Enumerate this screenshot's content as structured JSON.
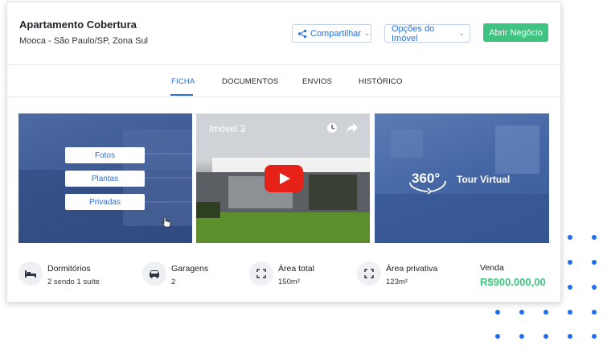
{
  "header": {
    "title": "Apartamento Cobertura",
    "address": "Mooca - São Paulo/SP, Zona Sul",
    "share_label": "Compartilhar",
    "options_label": "Opções do Imóvel",
    "open_deal_label": "Abrir Negócio"
  },
  "tabs": [
    {
      "label": "FICHA",
      "active": true
    },
    {
      "label": "DOCUMENTOS",
      "active": false
    },
    {
      "label": "ENVIOS",
      "active": false
    },
    {
      "label": "HISTÓRICO",
      "active": false
    }
  ],
  "media": {
    "photo_buttons": [
      "Fotos",
      "Plantas",
      "Privadas"
    ],
    "video_title": "Imóvel 3",
    "tour_number": "360°",
    "tour_label": "Tour Virtual"
  },
  "stats": [
    {
      "icon": "bed-icon",
      "label": "Dormitórios",
      "value": "2 sendo 1 suíte"
    },
    {
      "icon": "car-icon",
      "label": "Garagens",
      "value": "2"
    },
    {
      "icon": "expand-icon",
      "label": "Área total",
      "value": "150m²"
    },
    {
      "icon": "expand-icon",
      "label": "Área privativa",
      "value": "123m²"
    }
  ],
  "price": {
    "label": "Venda",
    "value": "R$900.000,00"
  },
  "colors": {
    "primary": "#2a6fd6",
    "success": "#3fc380",
    "play": "#e62117"
  }
}
